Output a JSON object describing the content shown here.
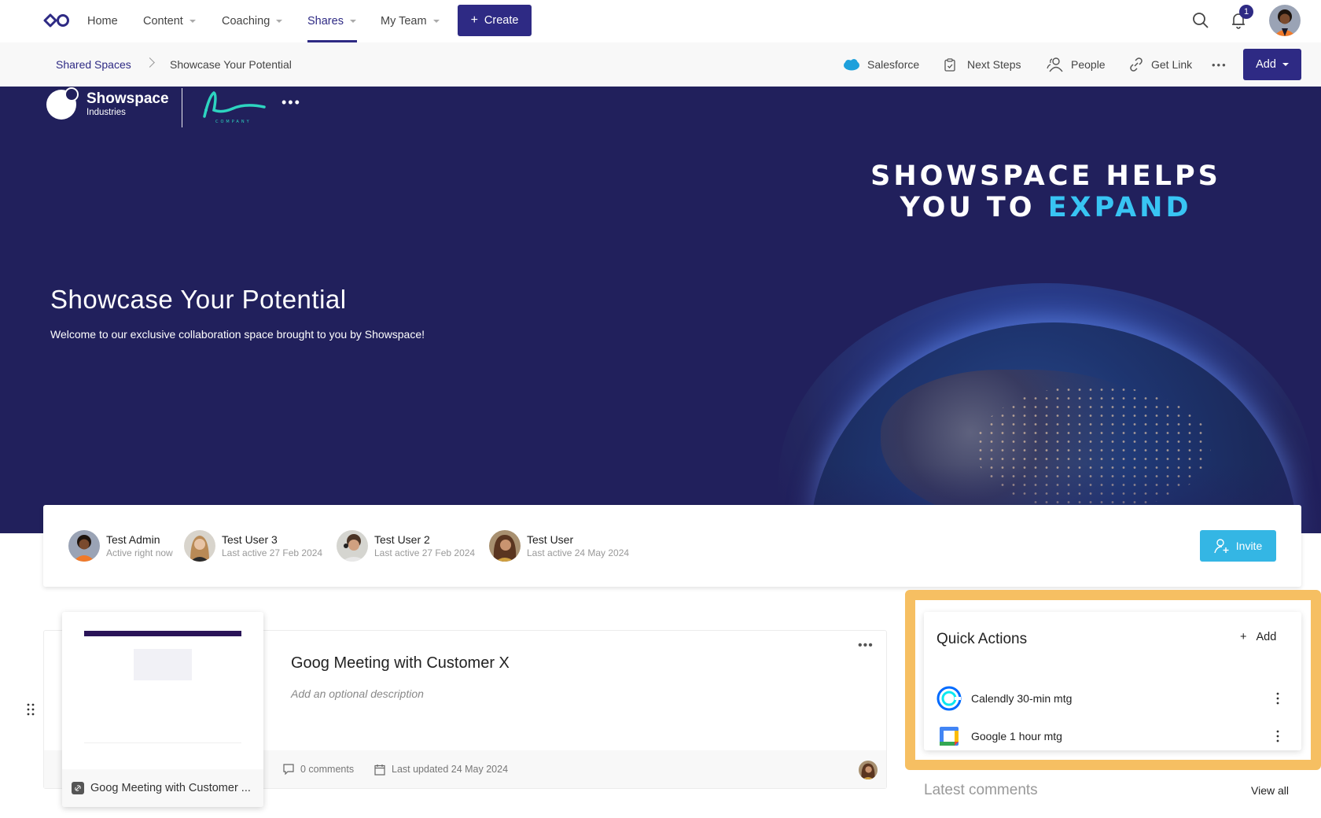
{
  "topnav": {
    "items": [
      {
        "label": "Home",
        "has_caret": false,
        "active": false
      },
      {
        "label": "Content",
        "has_caret": true,
        "active": false
      },
      {
        "label": "Coaching",
        "has_caret": true,
        "active": false
      },
      {
        "label": "Shares",
        "has_caret": true,
        "active": true
      },
      {
        "label": "My Team",
        "has_caret": true,
        "active": false
      }
    ],
    "create_label": "Create",
    "notification_count": "1",
    "icons": {
      "logo": "infinity-logo-icon",
      "search": "search-icon",
      "bell": "bell-icon"
    }
  },
  "breadcrumb": {
    "parent": "Shared Spaces",
    "current": "Showcase Your Potential"
  },
  "subbar": {
    "actions": [
      {
        "label": "Salesforce",
        "icon": "salesforce-cloud-icon"
      },
      {
        "label": "Next Steps",
        "icon": "clipboard-check-icon"
      },
      {
        "label": "People",
        "icon": "people-icon"
      },
      {
        "label": "Get Link",
        "icon": "link-icon"
      }
    ],
    "more_label": "•••",
    "add_label": "Add"
  },
  "hero": {
    "brand_name": "Showspace",
    "brand_sub": "Industries",
    "partner_logo_text": "COMPANY",
    "more_label": "•••",
    "tagline_line1": "SHOWSPACE HELPS",
    "tagline_line2_prefix": "YOU TO",
    "tagline_highlight": "EXPAND",
    "title": "Showcase Your Potential",
    "subtitle": "Welcome to our exclusive collaboration space brought to you by Showspace!"
  },
  "members": {
    "list": [
      {
        "name": "Test Admin",
        "status": "Active right now"
      },
      {
        "name": "Test User 3",
        "status": "Last active 27 Feb 2024"
      },
      {
        "name": "Test User 2",
        "status": "Last active 27 Feb 2024"
      },
      {
        "name": "Test User",
        "status": "Last active 24 May 2024"
      }
    ],
    "invite_label": "Invite"
  },
  "content_item": {
    "title": "Goog Meeting with Customer X",
    "description_placeholder": "Add an optional description",
    "thumb_name": "Goog Meeting with Customer ...",
    "comments": "0 comments",
    "last_updated": "Last updated 24 May 2024",
    "more_label": "•••"
  },
  "quick_actions": {
    "title": "Quick Actions",
    "add_label": "Add",
    "items": [
      {
        "label": "Calendly 30-min mtg",
        "icon": "calendly-icon"
      },
      {
        "label": "Google 1 hour mtg",
        "icon": "google-calendar-icon"
      }
    ],
    "highlight_color": "#f6bf62"
  },
  "latest_comments": {
    "title": "Latest comments",
    "view_all_label": "View all"
  },
  "colors": {
    "brand": "#2e2a84",
    "hero_bg": "#21205c",
    "invite": "#34b6e4",
    "tagline_highlight": "#38c4f3"
  }
}
